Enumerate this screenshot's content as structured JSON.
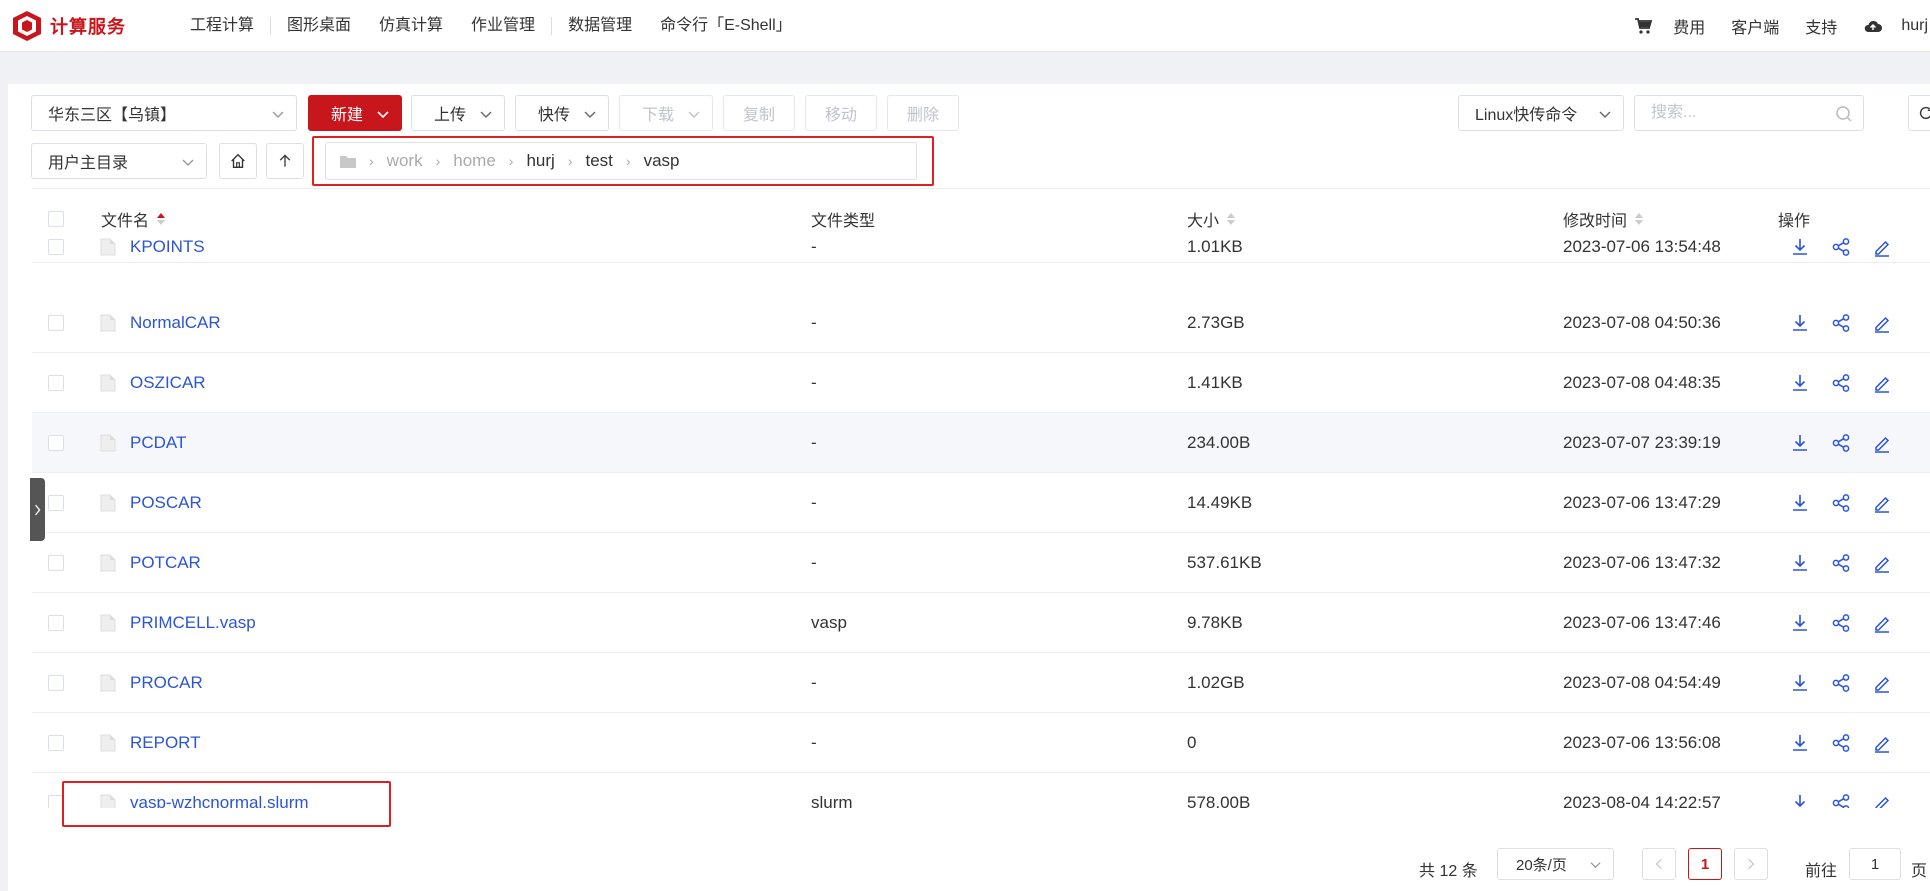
{
  "nav": {
    "brand": "计算服务",
    "left_items": [
      "工程计算",
      "图形桌面",
      "仿真计算",
      "作业管理",
      "数据管理",
      "命令行「E-Shell」"
    ],
    "right_items": {
      "cost": "费用",
      "client": "客户端",
      "support": "支持",
      "user": "hurj"
    }
  },
  "toolbar": {
    "region": "华东三区【乌镇】",
    "new": "新建",
    "upload": "上传",
    "fast": "快传",
    "download": "下载",
    "copy": "复制",
    "move": "移动",
    "delete": "删除",
    "linux_cmd": "Linux快传命令",
    "search_placeholder": "搜索...",
    "home_dir": "用户主目录"
  },
  "breadcrumb": [
    "work",
    "home",
    "hurj",
    "test",
    "vasp"
  ],
  "table": {
    "headers": {
      "name": "文件名",
      "type": "文件类型",
      "size": "大小",
      "mtime": "修改时间",
      "ops": "操作"
    },
    "rows": [
      {
        "name": "KPOINTS",
        "type": "-",
        "size": "1.01KB",
        "mtime": "2023-07-06 13:54:48"
      },
      {
        "name": "NormalCAR",
        "type": "-",
        "size": "2.73GB",
        "mtime": "2023-07-08 04:50:36"
      },
      {
        "name": "OSZICAR",
        "type": "-",
        "size": "1.41KB",
        "mtime": "2023-07-08 04:48:35"
      },
      {
        "name": "PCDAT",
        "type": "-",
        "size": "234.00B",
        "mtime": "2023-07-07 23:39:19"
      },
      {
        "name": "POSCAR",
        "type": "-",
        "size": "14.49KB",
        "mtime": "2023-07-06 13:47:29"
      },
      {
        "name": "POTCAR",
        "type": "-",
        "size": "537.61KB",
        "mtime": "2023-07-06 13:47:32"
      },
      {
        "name": "PRIMCELL.vasp",
        "type": "vasp",
        "size": "9.78KB",
        "mtime": "2023-07-06 13:47:46"
      },
      {
        "name": "PROCAR",
        "type": "-",
        "size": "1.02GB",
        "mtime": "2023-07-08 04:54:49"
      },
      {
        "name": "REPORT",
        "type": "-",
        "size": "0",
        "mtime": "2023-07-06 13:56:08"
      },
      {
        "name": "vasp-wzhcnormal.slurm",
        "type": "slurm",
        "size": "578.00B",
        "mtime": "2023-08-04 14:22:57"
      }
    ]
  },
  "pagination": {
    "total": "共 12 条",
    "page_size": "20条/页",
    "current": "1",
    "goto": "前往",
    "goto_value": "1",
    "page_unit": "页"
  },
  "colors": {
    "brand_red": "#c8161d",
    "link_blue": "#2b55d6",
    "highlight_outline": "#e02020"
  }
}
